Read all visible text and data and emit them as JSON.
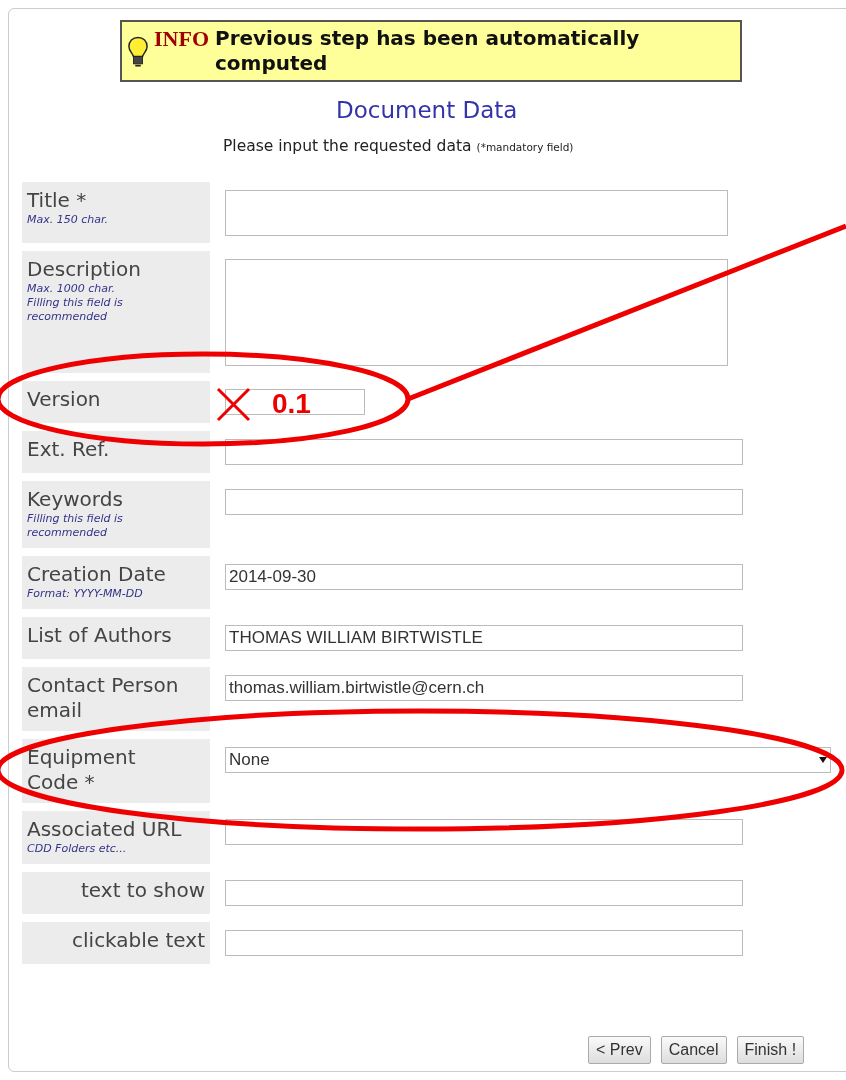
{
  "info": {
    "label": "INFO",
    "message": "Previous step has been automatically computed"
  },
  "heading": "Document Data",
  "instructions": {
    "text": "Please input the requested data",
    "note": "(*mandatory field)"
  },
  "fields": [
    {
      "kind": "textarea",
      "label": "Title *",
      "hint": "Max. 150 char.",
      "right_aligned": false
    },
    {
      "kind": "textarea-large",
      "label": "Description",
      "hint": "Max. 1000 char. Filling this field is recommended",
      "right_aligned": false
    },
    {
      "kind": "short-input",
      "label": "Version",
      "right_aligned": false
    },
    {
      "kind": "input",
      "label": "Ext. Ref.",
      "right_aligned": false
    },
    {
      "kind": "input",
      "label": "Keywords",
      "hint": "Filling this field is recommended",
      "right_aligned": false
    },
    {
      "kind": "input",
      "label": "Creation Date",
      "hint": "Format: YYYY-MM-DD",
      "value": "2014-09-30",
      "right_aligned": false
    },
    {
      "kind": "input",
      "label": "List of Authors",
      "value": "THOMAS WILLIAM BIRTWISTLE",
      "right_aligned": false
    },
    {
      "kind": "input",
      "label": "Contact Person email",
      "value": "thomas.william.birtwistle@cern.ch",
      "right_aligned": false
    },
    {
      "kind": "select",
      "label": "Equipment Code *",
      "value": "None",
      "right_aligned": false
    },
    {
      "kind": "input",
      "label": "Associated URL",
      "hint": "CDD Folders etc...",
      "right_aligned": false
    },
    {
      "kind": "input",
      "label": "text to show",
      "right_aligned": true
    },
    {
      "kind": "input",
      "label": "clickable text",
      "right_aligned": true
    }
  ],
  "buttons": [
    "< Prev",
    "Cancel",
    "Finish !"
  ],
  "annotation": {
    "value": "0.1"
  }
}
